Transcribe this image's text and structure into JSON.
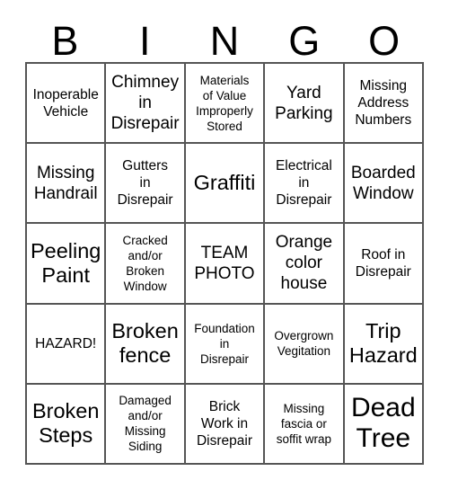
{
  "card": {
    "title": "BINGO Card",
    "header_letters": [
      "B",
      "I",
      "N",
      "G",
      "O"
    ],
    "grid_size": "5x5",
    "colors": {
      "background": "#ffffff",
      "text": "#000000",
      "grid_line": "#555555"
    },
    "free_space": {
      "row": 3,
      "column": 3,
      "label": "TEAM\nPHOTO"
    },
    "rows": [
      [
        {
          "label": "Inoperable\nVehicle",
          "size": "sm"
        },
        {
          "label": "Chimney\nin\nDisrepair",
          "size": "md"
        },
        {
          "label": "Materials\nof Value\nImproperly\nStored",
          "size": "xs"
        },
        {
          "label": "Yard\nParking",
          "size": "md"
        },
        {
          "label": "Missing\nAddress\nNumbers",
          "size": "sm"
        }
      ],
      [
        {
          "label": "Missing\nHandrail",
          "size": "md"
        },
        {
          "label": "Gutters\nin\nDisrepair",
          "size": "sm"
        },
        {
          "label": "Graffiti",
          "size": "lg"
        },
        {
          "label": "Electrical\nin\nDisrepair",
          "size": "sm"
        },
        {
          "label": "Boarded\nWindow",
          "size": "md"
        }
      ],
      [
        {
          "label": "Peeling\nPaint",
          "size": "lg"
        },
        {
          "label": "Cracked\nand/or\nBroken\nWindow",
          "size": "xs"
        },
        {
          "label": "TEAM\nPHOTO",
          "size": "md"
        },
        {
          "label": "Orange\ncolor\nhouse",
          "size": "md"
        },
        {
          "label": "Roof in\nDisrepair",
          "size": "sm"
        }
      ],
      [
        {
          "label": "HAZARD!",
          "size": "sm"
        },
        {
          "label": "Broken\nfence",
          "size": "lg"
        },
        {
          "label": "Foundation\nin\nDisrepair",
          "size": "xs"
        },
        {
          "label": "Overgrown\nVegitation",
          "size": "xs"
        },
        {
          "label": "Trip\nHazard",
          "size": "lg"
        }
      ],
      [
        {
          "label": "Broken\nSteps",
          "size": "lg"
        },
        {
          "label": "Damaged\nand/or\nMissing\nSiding",
          "size": "xs"
        },
        {
          "label": "Brick\nWork in\nDisrepair",
          "size": "sm"
        },
        {
          "label": "Missing\nfascia or\nsoffit wrap",
          "size": "xs"
        },
        {
          "label": "Dead\nTree",
          "size": "xl"
        }
      ]
    ]
  }
}
